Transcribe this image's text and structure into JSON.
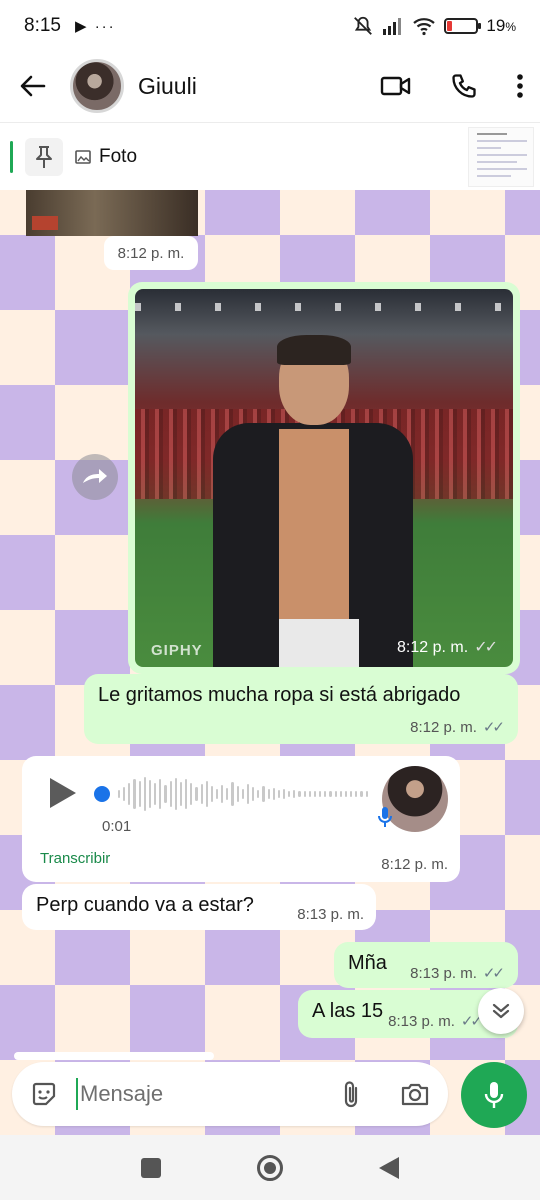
{
  "status_bar": {
    "time": "8:15",
    "left_icons": "▶ ···",
    "battery_percent": "19",
    "battery_suffix": "%"
  },
  "header": {
    "contact_name": "Giuuli"
  },
  "pinned": {
    "label": "Foto"
  },
  "messages": {
    "photo_time": "8:12 p. m.",
    "gif_watermark": "GIPHY",
    "gif_time": "8:12 p. m.",
    "out1_text": "Le gritamos mucha ropa si está abrigado",
    "out1_time": "8:12 p. m.",
    "voice_duration": "0:01",
    "voice_transcribe": "Transcribir",
    "voice_time": "8:12 p. m.",
    "in1_text": "Perp cuando va a estar?",
    "in1_time": "8:13 p. m.",
    "out2_text": "Mña",
    "out2_time": "8:13 p. m.",
    "out3_text": "A las 15",
    "out3_time": "8:13 p. m.",
    "ticks": "✓✓"
  },
  "composer": {
    "placeholder": "Mensaje"
  },
  "colors": {
    "accent_green": "#1fa855",
    "outgoing_bubble": "#d9fdd3",
    "wallpaper_purple": "#c9b6e8",
    "wallpaper_cream": "#fff0e2"
  }
}
